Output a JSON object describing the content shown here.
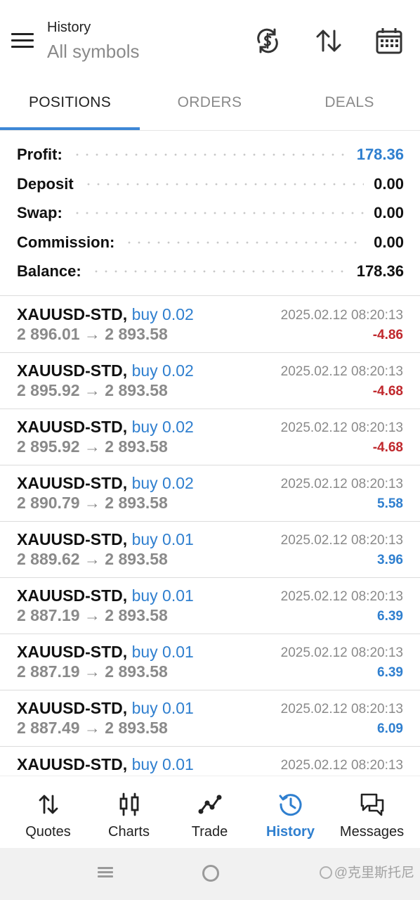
{
  "header": {
    "title": "History",
    "subtitle": "All symbols",
    "icons": [
      "currency-exchange-icon",
      "sort-icon",
      "calendar-icon"
    ]
  },
  "tabs": [
    {
      "label": "POSITIONS",
      "active": true
    },
    {
      "label": "ORDERS",
      "active": false
    },
    {
      "label": "DEALS",
      "active": false
    }
  ],
  "summary": [
    {
      "label": "Profit:",
      "value": "178.36",
      "color": "#2f7fcf"
    },
    {
      "label": "Deposit",
      "value": "0.00",
      "color": "#111111"
    },
    {
      "label": "Swap:",
      "value": "0.00",
      "color": "#111111"
    },
    {
      "label": "Commission:",
      "value": "0.00",
      "color": "#111111"
    },
    {
      "label": "Balance:",
      "value": "178.36",
      "color": "#111111"
    }
  ],
  "positions": [
    {
      "symbol": "XAUUSD-STD,",
      "type": "buy 0.02",
      "prices": "2 896.01 → 2 893.58",
      "date": "2025.02.12 08:20:13",
      "profit": "-4.86",
      "sign": "neg"
    },
    {
      "symbol": "XAUUSD-STD,",
      "type": "buy 0.02",
      "prices": "2 895.92 → 2 893.58",
      "date": "2025.02.12 08:20:13",
      "profit": "-4.68",
      "sign": "neg"
    },
    {
      "symbol": "XAUUSD-STD,",
      "type": "buy 0.02",
      "prices": "2 895.92 → 2 893.58",
      "date": "2025.02.12 08:20:13",
      "profit": "-4.68",
      "sign": "neg"
    },
    {
      "symbol": "XAUUSD-STD,",
      "type": "buy 0.02",
      "prices": "2 890.79 → 2 893.58",
      "date": "2025.02.12 08:20:13",
      "profit": "5.58",
      "sign": "pos"
    },
    {
      "symbol": "XAUUSD-STD,",
      "type": "buy 0.01",
      "prices": "2 889.62 → 2 893.58",
      "date": "2025.02.12 08:20:13",
      "profit": "3.96",
      "sign": "pos"
    },
    {
      "symbol": "XAUUSD-STD,",
      "type": "buy 0.01",
      "prices": "2 887.19 → 2 893.58",
      "date": "2025.02.12 08:20:13",
      "profit": "6.39",
      "sign": "pos"
    },
    {
      "symbol": "XAUUSD-STD,",
      "type": "buy 0.01",
      "prices": "2 887.19 → 2 893.58",
      "date": "2025.02.12 08:20:13",
      "profit": "6.39",
      "sign": "pos"
    },
    {
      "symbol": "XAUUSD-STD,",
      "type": "buy 0.01",
      "prices": "2 887.49 → 2 893.58",
      "date": "2025.02.12 08:20:13",
      "profit": "6.09",
      "sign": "pos"
    },
    {
      "symbol": "XAUUSD-STD,",
      "type": "buy 0.01",
      "prices": "",
      "date": "2025.02.12 08:20:13",
      "profit": "",
      "sign": "pos"
    }
  ],
  "nav": [
    {
      "label": "Quotes",
      "icon": "quotes-icon",
      "active": false
    },
    {
      "label": "Charts",
      "icon": "charts-icon",
      "active": false
    },
    {
      "label": "Trade",
      "icon": "trade-icon",
      "active": false
    },
    {
      "label": "History",
      "icon": "history-icon",
      "active": true
    },
    {
      "label": "Messages",
      "icon": "messages-icon",
      "active": false
    }
  ],
  "watermark": "@克里斯托尼",
  "colors": {
    "accent": "#2f7fcf",
    "negative": "#c0282d",
    "muted": "#8a8a8a"
  }
}
